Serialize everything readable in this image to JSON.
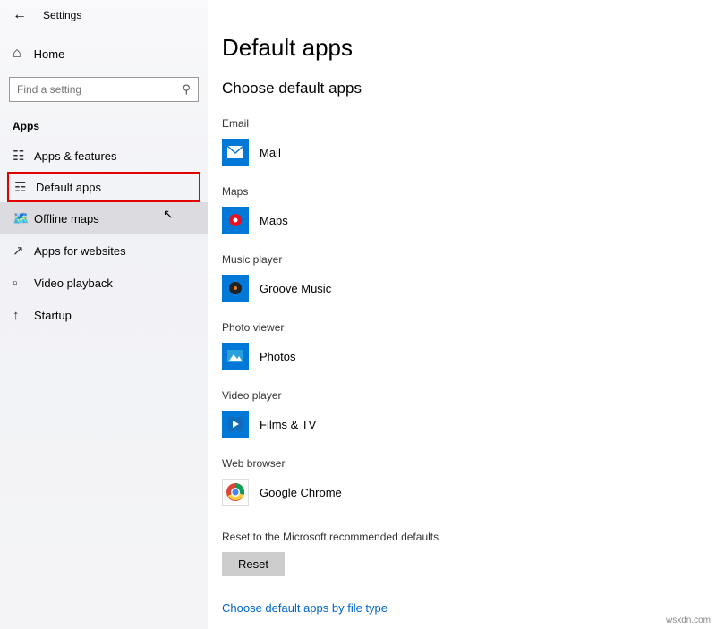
{
  "header": {
    "title": "Settings"
  },
  "home": {
    "label": "Home"
  },
  "search": {
    "placeholder": "Find a setting"
  },
  "section": "Apps",
  "nav": [
    {
      "label": "Apps & features"
    },
    {
      "label": "Default apps"
    },
    {
      "label": "Offline maps"
    },
    {
      "label": "Apps for websites"
    },
    {
      "label": "Video playback"
    },
    {
      "label": "Startup"
    }
  ],
  "main": {
    "title": "Default apps",
    "subtitle": "Choose default apps",
    "categories": [
      {
        "label": "Email",
        "app": "Mail"
      },
      {
        "label": "Maps",
        "app": "Maps"
      },
      {
        "label": "Music player",
        "app": "Groove Music"
      },
      {
        "label": "Photo viewer",
        "app": "Photos"
      },
      {
        "label": "Video player",
        "app": "Films & TV"
      },
      {
        "label": "Web browser",
        "app": "Google Chrome"
      }
    ],
    "reset_label": "Reset to the Microsoft recommended defaults",
    "reset_button": "Reset",
    "link": "Choose default apps by file type"
  },
  "watermark": "wsxdn.com"
}
